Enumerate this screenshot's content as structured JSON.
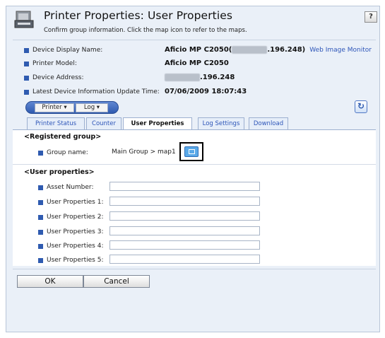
{
  "header": {
    "title": "Printer Properties: User Properties",
    "subtitle": "Confirm group information. Click the map icon to refer to the maps.",
    "help_label": "?"
  },
  "device_info": [
    {
      "label": "Device Display Name:",
      "value_prefix": "Aficio MP C2050(",
      "value_masked": "███.███",
      "value_suffix": ".196.248)",
      "link": "Web Image Monitor"
    },
    {
      "label": "Printer Model:",
      "value": "Aficio MP C2050"
    },
    {
      "label": "Device Address:",
      "value_masked": "███.███",
      "value_suffix": ".196.248"
    },
    {
      "label": "Latest Device Information Update Time:",
      "value": "07/06/2009 18:07:43"
    }
  ],
  "menu": {
    "printer_label": "Printer ▾",
    "log_label": "Log ▾"
  },
  "tabs": [
    {
      "label": "Printer Status",
      "active": false
    },
    {
      "label": "Counter",
      "active": false
    },
    {
      "label": "User Properties",
      "active": true
    },
    {
      "label": "Log Settings",
      "active": false
    },
    {
      "label": "Download",
      "active": false
    }
  ],
  "registered_group": {
    "heading": "<Registered group>",
    "group_label": "Group name:",
    "group_value": "Main Group > map1"
  },
  "user_properties": {
    "heading": "<User properties>",
    "fields": [
      {
        "label": "Asset Number:",
        "value": ""
      },
      {
        "label": "User Properties 1:",
        "value": ""
      },
      {
        "label": "User Properties 2:",
        "value": ""
      },
      {
        "label": "User Properties 3:",
        "value": ""
      },
      {
        "label": "User Properties 4:",
        "value": ""
      },
      {
        "label": "User Properties 5:",
        "value": ""
      }
    ]
  },
  "buttons": {
    "ok": "OK",
    "cancel": "Cancel"
  },
  "colors": {
    "accent": "#2f5bb0",
    "panel_bg": "#eaf0f8",
    "link": "#2d55b8"
  },
  "icons": {
    "header": "printer-properties-icon",
    "help": "help-icon",
    "refresh": "refresh-icon",
    "map": "map-icon",
    "bullet": "square-bullet-icon"
  }
}
